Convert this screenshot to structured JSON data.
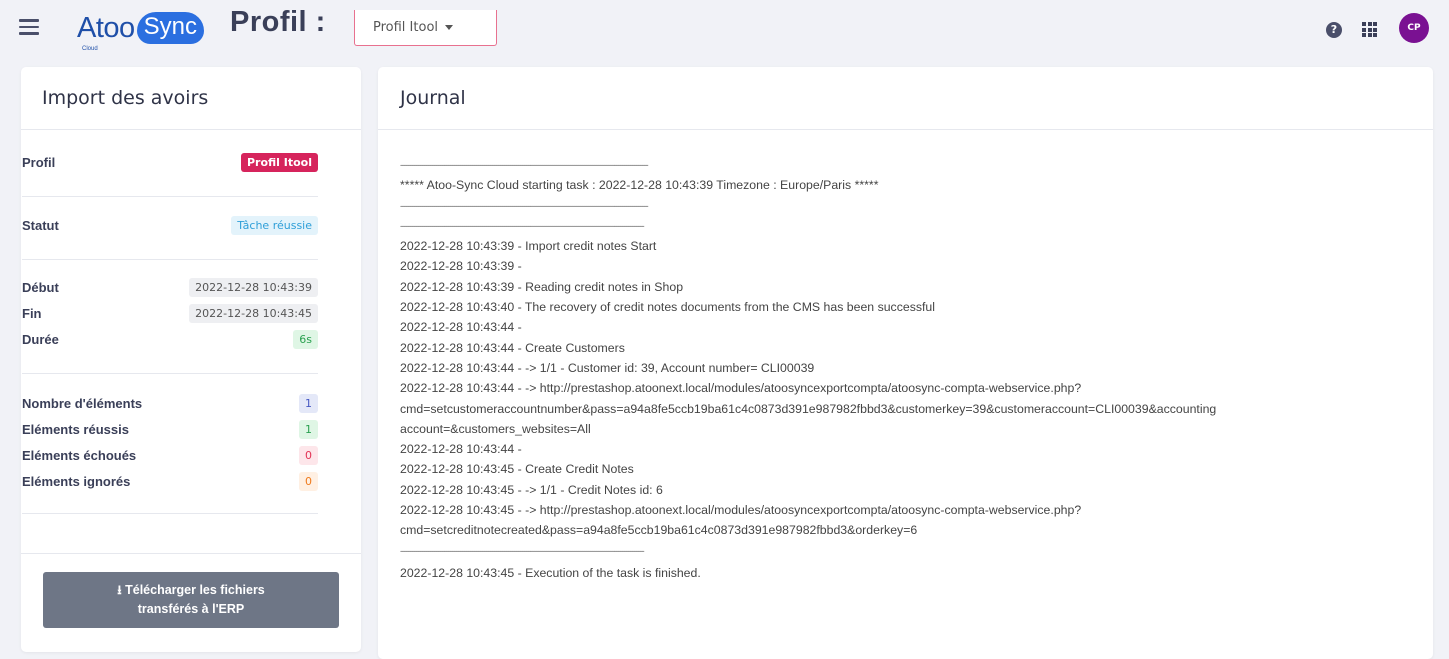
{
  "header": {
    "logo_text_1": "Atoo",
    "logo_text_2": "Sync",
    "logo_sub": "Cloud",
    "page_title": "Profil :",
    "profile_select_value": "Profil Itool",
    "help_icon": "question-circle-icon",
    "apps_icon": "grid-icon",
    "avatar_initials": "CP"
  },
  "left_panel": {
    "title": "Import des avoirs",
    "profil_label": "Profil",
    "profil_value": "Profil Itool",
    "statut_label": "Statut",
    "statut_value": "Tâche réussie",
    "debut_label": "Début",
    "debut_value": "2022-12-28 10:43:39",
    "fin_label": "Fin",
    "fin_value": "2022-12-28 10:43:45",
    "duree_label": "Durée",
    "duree_value": "6s",
    "nb_elements_label": "Nombre d'éléments",
    "nb_elements_value": "1",
    "reussis_label": "Eléments réussis",
    "reussis_value": "1",
    "echoues_label": "Eléments échoués",
    "echoues_value": "0",
    "ignores_label": "Eléments ignorés",
    "ignores_value": "0",
    "download_line1": "Télécharger les fichiers",
    "download_line2": "transférés à l'ERP",
    "download_icon": "download-icon"
  },
  "journal": {
    "title": "Journal",
    "lines": [
      "----------------------------------------------------------------------------------------------------------------------------",
      "***** Atoo-Sync Cloud starting task : 2022-12-28 10:43:39 Timezone : Europe/Paris *****",
      "----------------------------------------------------------------------------------------------------------------------------",
      "--------------------------------------------------------------------------------------------------------------------------",
      "2022-12-28 10:43:39 - Import credit notes Start",
      "2022-12-28 10:43:39 -",
      "2022-12-28 10:43:39 - Reading credit notes in Shop",
      "2022-12-28 10:43:40 - The recovery of credit notes documents from the CMS has been successful",
      "2022-12-28 10:43:44 -",
      "2022-12-28 10:43:44 - Create Customers",
      "2022-12-28 10:43:44 - -> 1/1 - Customer id: 39, Account number= CLI00039",
      "2022-12-28 10:43:44 - -> http://prestashop.atoonext.local/modules/atoosyncexportcompta/atoosync-compta-webservice.php?",
      "cmd=setcustomeraccountnumber&pass=a94a8fe5ccb19ba61c4c0873d391e987982fbbd3&customerkey=39&customeraccount=CLI00039&accounting",
      "account=&customers_websites=All",
      "2022-12-28 10:43:44 -",
      "2022-12-28 10:43:45 - Create Credit Notes",
      "2022-12-28 10:43:45 - -> 1/1 - Credit Notes id: 6",
      "2022-12-28 10:43:45 - -> http://prestashop.atoonext.local/modules/atoosyncexportcompta/atoosync-compta-webservice.php?",
      "cmd=setcreditnotecreated&pass=a94a8fe5ccb19ba61c4c0873d391e987982fbbd3&orderkey=6",
      "--------------------------------------------------------------------------------------------------------------------------",
      "2022-12-28 10:43:45 - Execution of the task is finished."
    ]
  }
}
